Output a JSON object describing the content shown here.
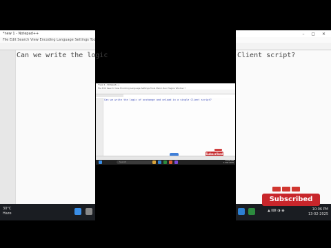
{
  "left_panel": {
    "window_title": "*new 1 - Notepad++",
    "menu_text": "File Edit Search View Encoding Language Settings Tools Macro",
    "code_text": "Can we write the logic",
    "weather_temp": "30°C",
    "weather_desc": "Haze"
  },
  "right_panel": {
    "code_text": "Client script?",
    "clock_time": "10:06 PM",
    "clock_date": "13-02-2025",
    "subscribed_label": "Subscribed"
  },
  "center_window": {
    "window_title": "*new 1 - Notepad++",
    "menu_text": "File Edit Search View Encoding Language Settings Tools Macro Run Plugins Window ?",
    "tab_label": "new 1",
    "code_text": "Can we write the logic of onchange and onload in a single Client script?",
    "search_placeholder": "Search",
    "clock_time": "10:06 PM",
    "clock_date": "13-02-2025",
    "subscribed_label": "Subscribed"
  },
  "colors": {
    "background": "#000000",
    "code_blue": "#3a4ab8",
    "subscribe_red": "#c8262b",
    "taskbar": "#1a1d22"
  }
}
